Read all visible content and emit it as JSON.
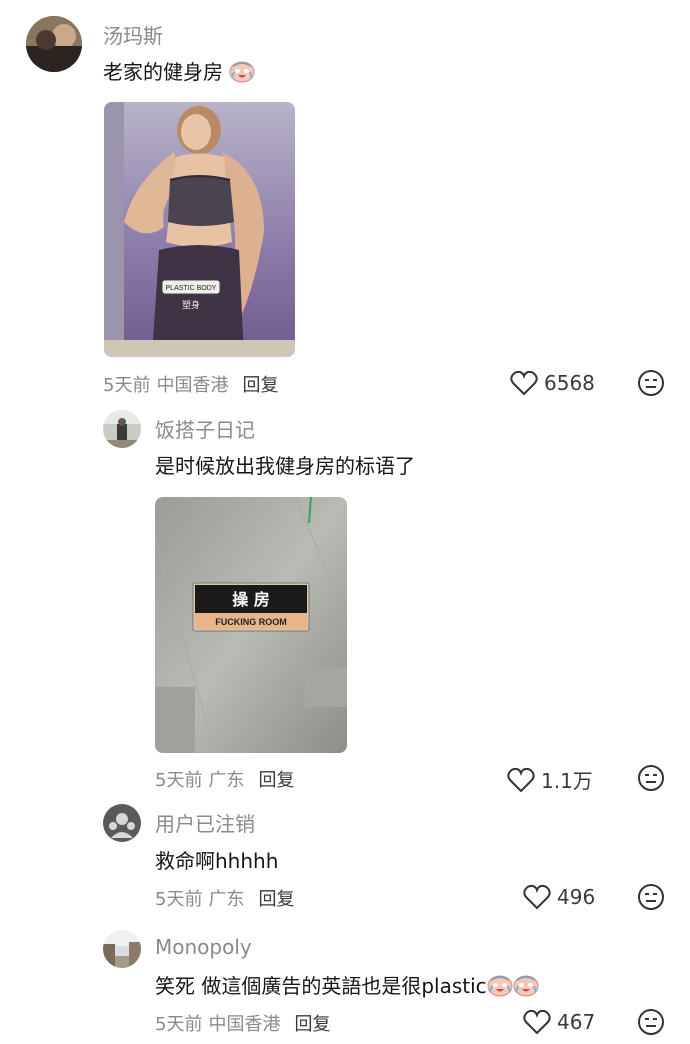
{
  "comments": [
    {
      "user": "汤玛斯",
      "text": "老家的健身房",
      "time": "5天前",
      "location": "中国香港",
      "reply_label": "回复",
      "likes": "6568",
      "photo_sign": {
        "label_en": "PLASTIC BODY",
        "label_cn": "塑身"
      }
    },
    {
      "user": "饭搭子日记",
      "text": "是时候放出我健身房的标语了",
      "time": "5天前",
      "location": "广东",
      "reply_label": "回复",
      "likes": "1.1万",
      "photo_sign": {
        "label_cn": "操 房",
        "label_en": "FUCKING ROOM"
      }
    },
    {
      "user": "用户已注销",
      "text": "救命啊hhhhh",
      "time": "5天前",
      "location": "广东",
      "reply_label": "回复",
      "likes": "496"
    },
    {
      "user": "Monopoly",
      "text": "笑死 做這個廣告的英語也是很plastic",
      "time": "5天前",
      "location": "中国香港",
      "reply_label": "回复",
      "likes": "467"
    }
  ]
}
